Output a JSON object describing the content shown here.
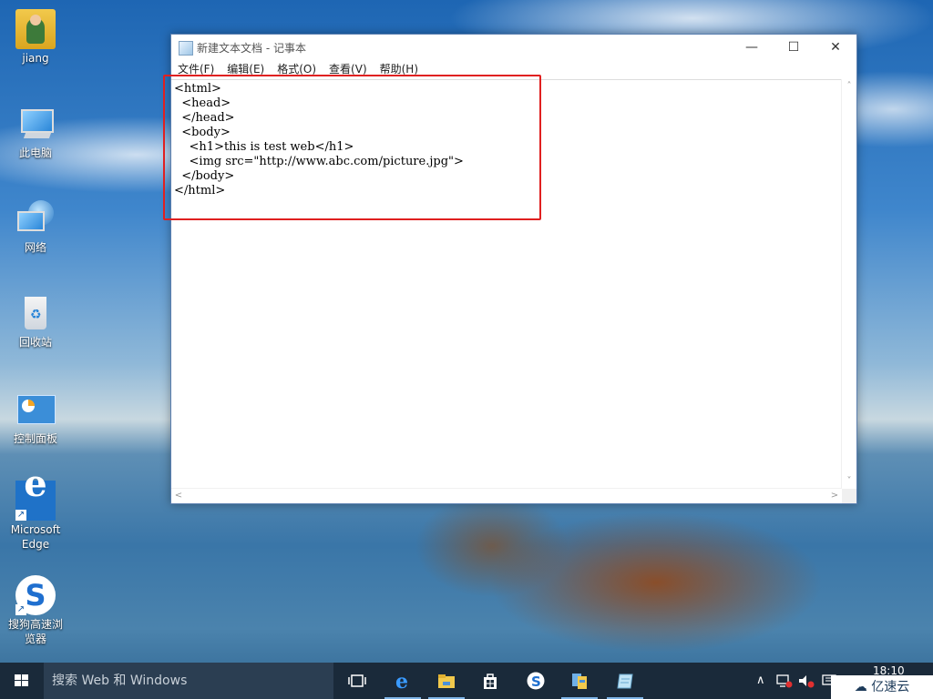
{
  "desktop": {
    "icons": [
      {
        "label": "jiang"
      },
      {
        "label": "此电脑"
      },
      {
        "label": "网络"
      },
      {
        "label": "回收站"
      },
      {
        "label": "控制面板"
      },
      {
        "label": "Microsoft Edge"
      },
      {
        "label": "搜狗高速浏览器"
      }
    ]
  },
  "notepad": {
    "title": "新建文本文档 - 记事本",
    "controls": {
      "minimize": "—",
      "maximize": "☐",
      "close": "✕"
    },
    "menu": [
      "文件(F)",
      "编辑(E)",
      "格式(O)",
      "查看(V)",
      "帮助(H)"
    ],
    "content": "<html>\n  <head>\n  </head>\n  <body>\n    <h1>this is test web</h1>\n    <img src=\"http://www.abc.com/picture.jpg\">\n  </body>\n</html>",
    "highlight_color": "#e02020"
  },
  "taskbar": {
    "search_placeholder": "搜索 Web 和 Windows",
    "apps": [
      "task-view",
      "edge",
      "file-explorer",
      "store",
      "sogou-browser",
      "app-6",
      "notepad"
    ],
    "tray_chevron": "∧",
    "clock_time": "18:10"
  },
  "watermark": {
    "text": "亿速云"
  }
}
